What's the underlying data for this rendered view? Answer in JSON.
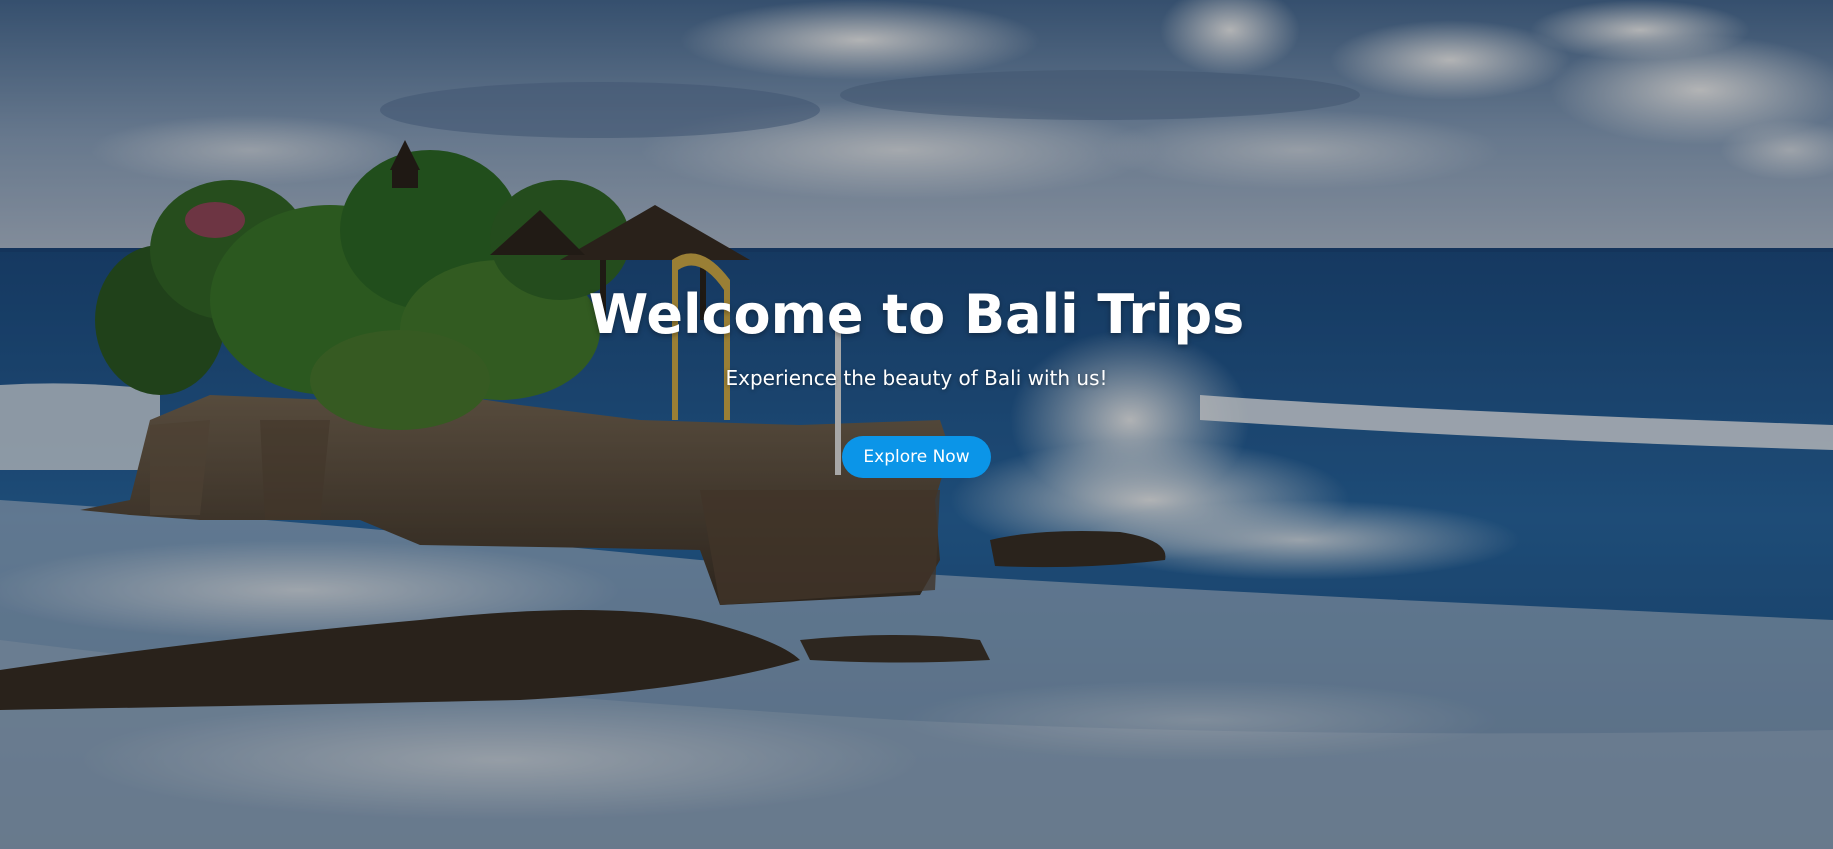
{
  "hero": {
    "title": "Welcome to Bali Trips",
    "subtitle": "Experience the beauty of Bali with us!",
    "cta_label": "Explore Now",
    "background_image": "bali-temple-ocean-photo",
    "accent_color": "#0b95e8"
  }
}
